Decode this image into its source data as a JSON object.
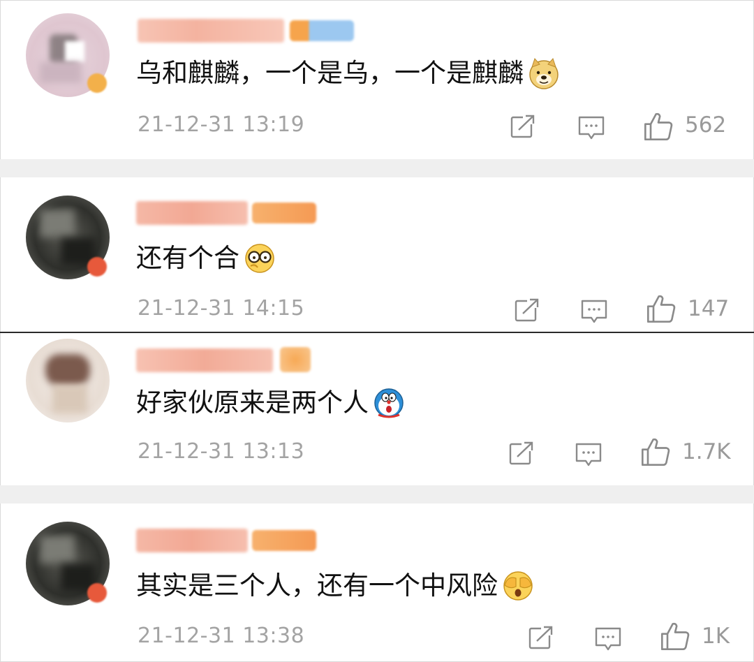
{
  "comments": [
    {
      "content": "乌和麒麟，一个是乌，一个是麒麟",
      "emoji": "doge-emoji",
      "time": "21-12-31 13:19",
      "likes": "562"
    },
    {
      "content": "还有个合",
      "emoji": "glasses-emoji",
      "time": "21-12-31 14:15",
      "likes": "147"
    },
    {
      "content": "好家伙原来是两个人",
      "emoji": "doraemon-emoji",
      "time": "21-12-31 13:13",
      "likes": "1.7K"
    },
    {
      "content": "其实是三个人，还有一个中风险",
      "emoji": "cover-eyes-emoji",
      "time": "21-12-31 13:38",
      "likes": "1K"
    }
  ],
  "icons": {
    "share": "share-icon",
    "reply": "comment-icon",
    "like": "thumbs-up-icon"
  },
  "colors": {
    "username_blur": "#f6b9a6",
    "level_badge_blur": "#f8b27a",
    "meta_text": "#a3a3a3",
    "separator": "#efefef"
  }
}
